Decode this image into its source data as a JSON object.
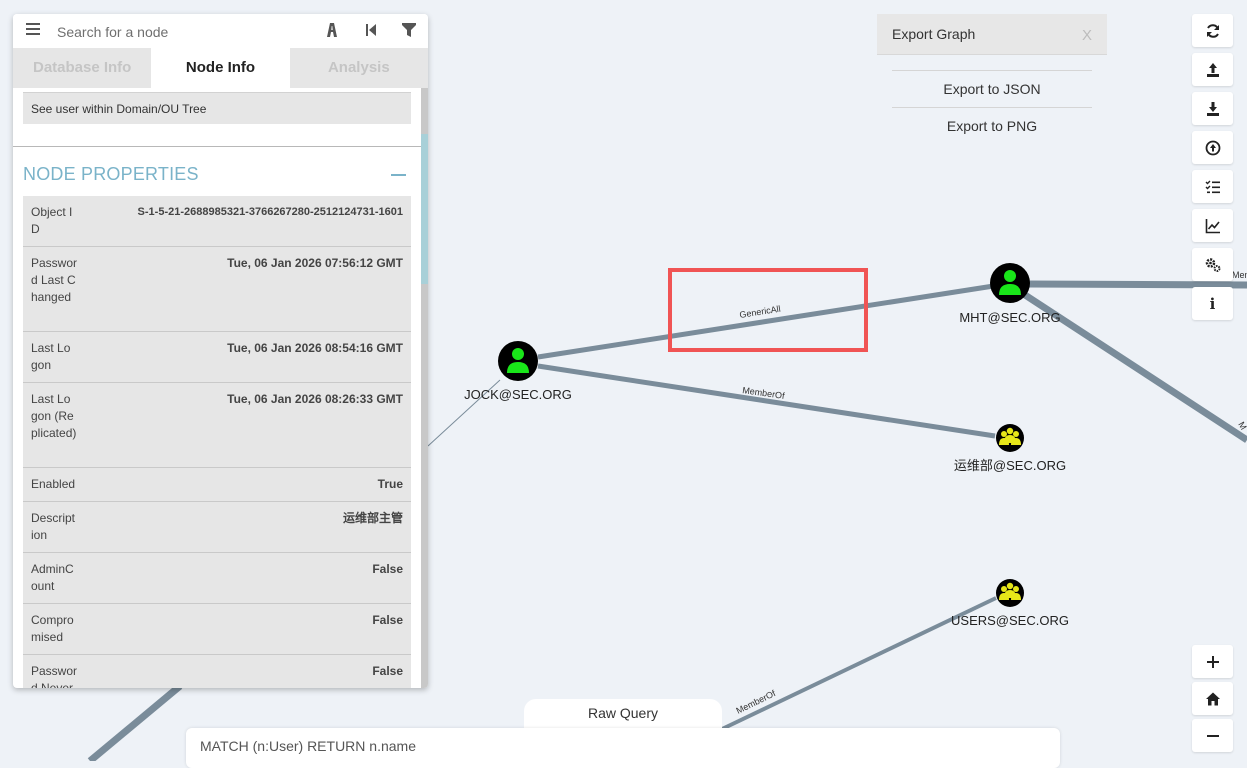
{
  "search": {
    "placeholder": "Search for a node"
  },
  "tabs": [
    {
      "label": "Database Info",
      "active": false
    },
    {
      "label": "Node Info",
      "active": true
    },
    {
      "label": "Analysis",
      "active": false
    }
  ],
  "node_info": {
    "tree_link": "See user within Domain/OU Tree",
    "section_title": "NODE PROPERTIES",
    "properties": [
      {
        "key": "Object ID",
        "value": "S-1-5-21-2688985321-3766267280-2512124731-1601"
      },
      {
        "key": "Password Last Changed",
        "value": "Tue, 06 Jan 2026 07:56:12 GMT"
      },
      {
        "key": "Last Logon",
        "value": "Tue, 06 Jan 2026 08:54:16 GMT"
      },
      {
        "key": "Last Logon (Replicated)",
        "value": "Tue, 06 Jan 2026 08:26:33 GMT"
      },
      {
        "key": "Enabled",
        "value": "True"
      },
      {
        "key": "Description",
        "value": "运维部主管"
      },
      {
        "key": "AdminCount",
        "value": "False"
      },
      {
        "key": "Compromised",
        "value": "False"
      },
      {
        "key": "Password Never Expires",
        "value": "False"
      }
    ]
  },
  "export": {
    "title": "Export Graph",
    "close": "X",
    "items": [
      "Export to JSON",
      "Export to PNG"
    ]
  },
  "graph": {
    "nodes": [
      {
        "label": "JOCK@SEC.ORG",
        "kind": "user"
      },
      {
        "label": "MHT@SEC.ORG",
        "kind": "user"
      },
      {
        "label": "运维部@SEC.ORG",
        "kind": "group"
      },
      {
        "label": "USERS@SEC.ORG",
        "kind": "group"
      }
    ],
    "edges": [
      {
        "label": "GenericAll",
        "highlighted": true
      },
      {
        "label": "MemberOf"
      },
      {
        "label": "MemberOf"
      },
      {
        "label": "Mem"
      },
      {
        "label": "M"
      }
    ],
    "highlight_color": "#f05454",
    "user_color": "#19e619",
    "group_color": "#e6e619",
    "edge_color": "#7a8c9a"
  },
  "toolbar": {
    "buttons": [
      "refresh-icon",
      "upload-icon",
      "download-icon",
      "import-icon",
      "checklist-icon",
      "chart-icon",
      "settings-icon",
      "info-icon"
    ],
    "info_label": "i",
    "zoom": [
      "zoom-in-icon",
      "home-icon",
      "zoom-out-icon"
    ]
  },
  "query": {
    "tab_label": "Raw Query",
    "value": "MATCH (n:User) RETURN n.name"
  }
}
